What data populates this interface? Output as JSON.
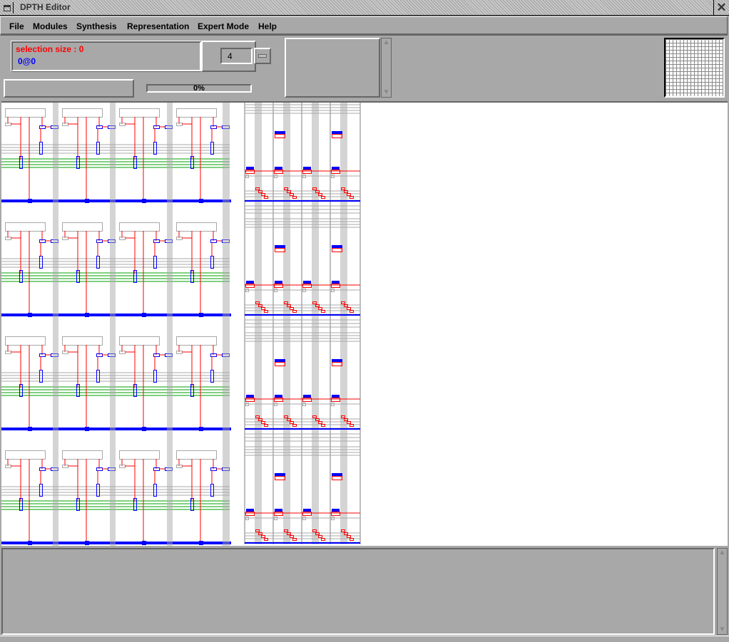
{
  "window": {
    "title": "DPTH Editor",
    "close_icon": "close-x-icon",
    "menu_icon": "window-menu-icon"
  },
  "menu": [
    "File",
    "Modules",
    "Synthesis",
    "Representation",
    "Expert Mode",
    "Help"
  ],
  "info": {
    "selection_label": "selection size : 0",
    "position": "0@0",
    "selection_color": "#ff0000",
    "position_color": "#0000ff"
  },
  "zoom_field": {
    "value": "4"
  },
  "progress": {
    "label": "0%",
    "value": 0
  },
  "colors": {
    "wire_red": "#ff0000",
    "wire_green": "#00a000",
    "contact_blue": "#0000ff",
    "bus_gray": "#a8a8a8"
  }
}
